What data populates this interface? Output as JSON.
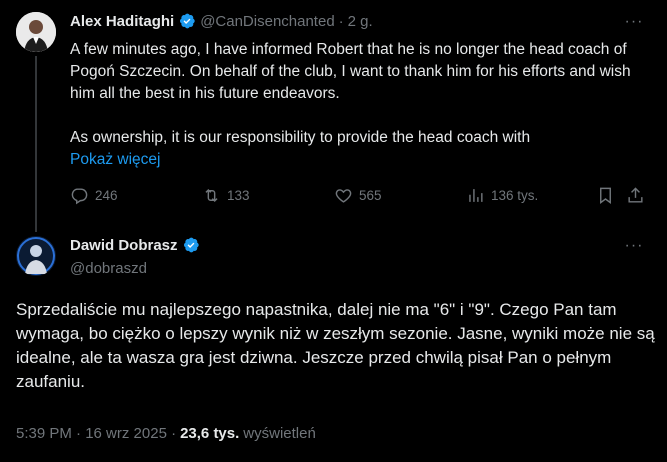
{
  "tweet1": {
    "author_name": "Alex Haditaghi",
    "handle": "@CanDisenchanted",
    "separator": "·",
    "time": "2 g.",
    "text_paragraph1": "A few minutes ago, I have informed Robert that he is no longer the head coach of Pogoń Szczecin. On behalf of the club, I want to thank him for his efforts and wish him all the best in his future endeavors.",
    "text_paragraph2": "As ownership, it is our responsibility to provide the head coach with",
    "show_more": "Pokaż więcej",
    "actions": {
      "replies": "246",
      "reposts": "133",
      "likes": "565",
      "views": "136 tys."
    },
    "icons": {
      "reply": "reply-icon",
      "repost": "repost-icon",
      "like": "heart-icon",
      "views": "views-icon",
      "bookmark": "bookmark-icon",
      "share": "share-icon"
    }
  },
  "tweet2": {
    "author_name": "Dawid Dobrasz",
    "handle": "@dobraszd",
    "text": "Sprzedaliście mu najlepszego napastnika, dalej nie ma \"6\" i \"9\". Czego Pan tam wymaga, bo ciężko o lepszy wynik niż w zeszłym sezonie. Jasne, wyniki może nie są idealne, ale ta wasza gra jest dziwna. Jeszcze przed chwilą pisał Pan o pełnym zaufaniu.",
    "timestamp": "5:39 PM · 16 wrz 2025 ·",
    "views_count": "23,6 tys.",
    "views_label": "wyświetleń"
  },
  "more_symbol": "···",
  "colors": {
    "background": "#000000",
    "text": "#e7e9ea",
    "muted": "#71767b",
    "link": "#1d9bf0",
    "verified": "#1d9bf0"
  }
}
